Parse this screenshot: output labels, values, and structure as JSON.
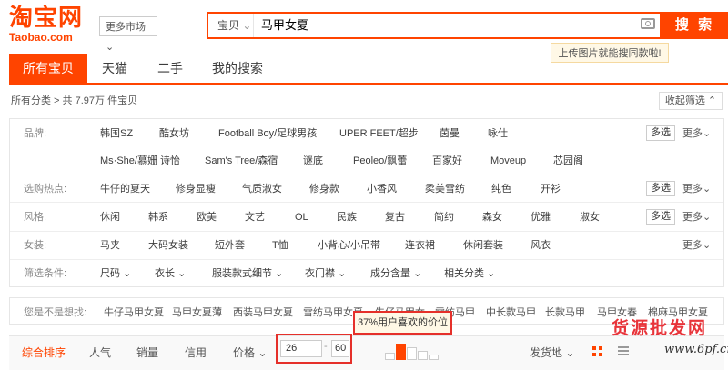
{
  "header": {
    "logo_cn": "淘宝网",
    "logo_en": "Taobao.com",
    "more_market": "更多市场",
    "search_category": "宝贝",
    "search_value": "马甲女夏",
    "search_button": "搜 索",
    "upload_tip": "上传图片就能搜同款啦!"
  },
  "tabs": [
    "所有宝贝",
    "天猫",
    "二手",
    "我的搜索"
  ],
  "breadcrumb": {
    "all": "所有分类",
    "count": "共 7.97万 件宝贝"
  },
  "collapse_label": "收起筛选",
  "multi_label": "多选",
  "more_label": "更多",
  "filters": {
    "brand": {
      "label": "品牌:",
      "row1": [
        "韩国SZ",
        "酷女坊",
        "Football Boy/足球男孩",
        "UPER FEET/超步",
        "茵曼",
        "咏仕"
      ],
      "row2": [
        "Ms·She/慕姗 诗怡",
        "Sam's Tree/森宿",
        "谜底",
        "Peoleo/飘蕾",
        "百家好",
        "Moveup",
        "芯园阁"
      ]
    },
    "hot": {
      "label": "选购热点:",
      "items": [
        "牛仔的夏天",
        "修身显瘦",
        "气质淑女",
        "修身款",
        "小香风",
        "柔美雪纺",
        "纯色",
        "开衫"
      ]
    },
    "style": {
      "label": "风格:",
      "items": [
        "休闲",
        "韩系",
        "欧美",
        "文艺",
        "OL",
        "民族",
        "复古",
        "简约",
        "森女",
        "优雅",
        "淑女"
      ]
    },
    "women": {
      "label": "女装:",
      "items": [
        "马夹",
        "大码女装",
        "短外套",
        "T恤",
        "小背心/小吊带",
        "连衣裙",
        "休闲套装",
        "风衣"
      ]
    },
    "conditions": {
      "label": "筛选条件:",
      "items": [
        "尺码",
        "衣长",
        "服装款式细节",
        "衣门襟",
        "成分含量",
        "相关分类"
      ]
    }
  },
  "suggestions": {
    "label": "您是不是想找:",
    "items": [
      "牛仔马甲女夏",
      "马甲女夏薄",
      "西装马甲女夏",
      "雪纺马甲女夏",
      "牛仔马甲女",
      "雪纺马甲",
      "中长款马甲",
      "长款马甲",
      "马甲女春",
      "棉麻马甲女夏"
    ]
  },
  "sort": {
    "items": [
      "综合排序",
      "人气",
      "销量",
      "信用",
      "价格"
    ],
    "price_min": "26",
    "price_max": "60",
    "price_tip": "37%用户喜欢的价位",
    "location": "发货地"
  },
  "watermark": {
    "cn": "货源批发网",
    "url": "www.6pf.cn"
  },
  "colors": {
    "brand": "#ff4400",
    "highlight": "#e5302a"
  }
}
